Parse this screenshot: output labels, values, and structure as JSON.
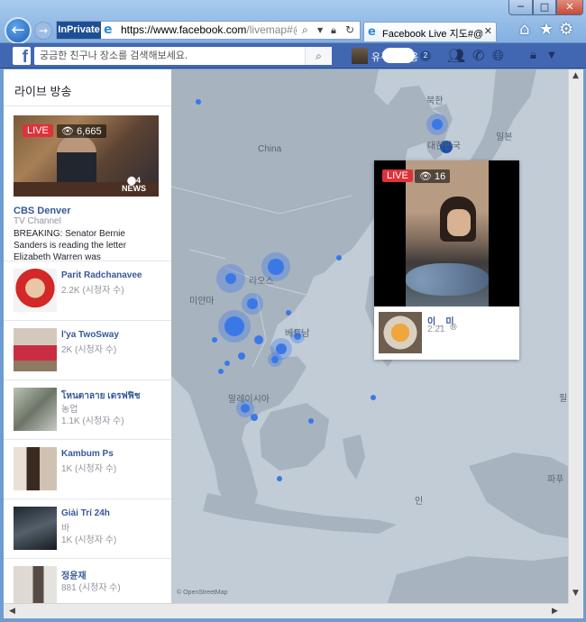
{
  "browser": {
    "inprivate_label": "InPrivate",
    "url_domain": "https://www.facebook.com",
    "url_rest": "/livemap#@12.3",
    "tab_title": "Facebook Live 지도#@...",
    "icons": [
      "back-icon",
      "forward-icon",
      "search-icon",
      "dropdown-icon",
      "lock-icon",
      "refresh-icon",
      "home-icon",
      "favorites-icon",
      "settings-icon"
    ]
  },
  "facebook": {
    "search_placeholder": "궁금한 친구나 장소를 검색해보세요.",
    "user_name": "유주",
    "user_name_end": "용",
    "notification_count": "2",
    "brand_color": "#4267b2"
  },
  "sidebar": {
    "title": "라이브 방송",
    "featured": {
      "live_label": "LIVE",
      "views": "6,665",
      "channel_logo": "NEWS",
      "channel": "CBS Denver",
      "type": "TV Channel",
      "description": "BREAKING: Senator Bernie Sanders is reading the letter Elizabeth Warren was"
    },
    "items": [
      {
        "name": "Parit Radchanavee",
        "sub": "2.2K (시청자 수)"
      },
      {
        "name": "l'ya TwoSway",
        "sub": "2K (시청자 수)"
      },
      {
        "name": "โหนตาลาย เดรฟฟิช",
        "sub": "농업",
        "sub2": "1.1K (시청자 수)"
      },
      {
        "name": "Kambum Ps",
        "sub": "1K (시청자 수)"
      },
      {
        "name": "Giải Trí 24h",
        "sub": "바",
        "sub2": "1K (시청자 수)"
      },
      {
        "name": "정윤재",
        "sub": "881 (시청자 수)"
      }
    ]
  },
  "map": {
    "labels": {
      "north_korea": "북한",
      "south_korea": "대한민국",
      "japan": "일본",
      "china": "China",
      "myanmar": "미얀마",
      "laos": "라오스",
      "vietnam": "베트남",
      "malaysia": "말레이시아",
      "philippines": "필",
      "papua": "파푸",
      "indonesia": "인"
    },
    "attribution": "© OpenStreetMap",
    "popup": {
      "live_label": "LIVE",
      "views": "16",
      "name": "이 _ 미",
      "time": "2:21"
    }
  }
}
